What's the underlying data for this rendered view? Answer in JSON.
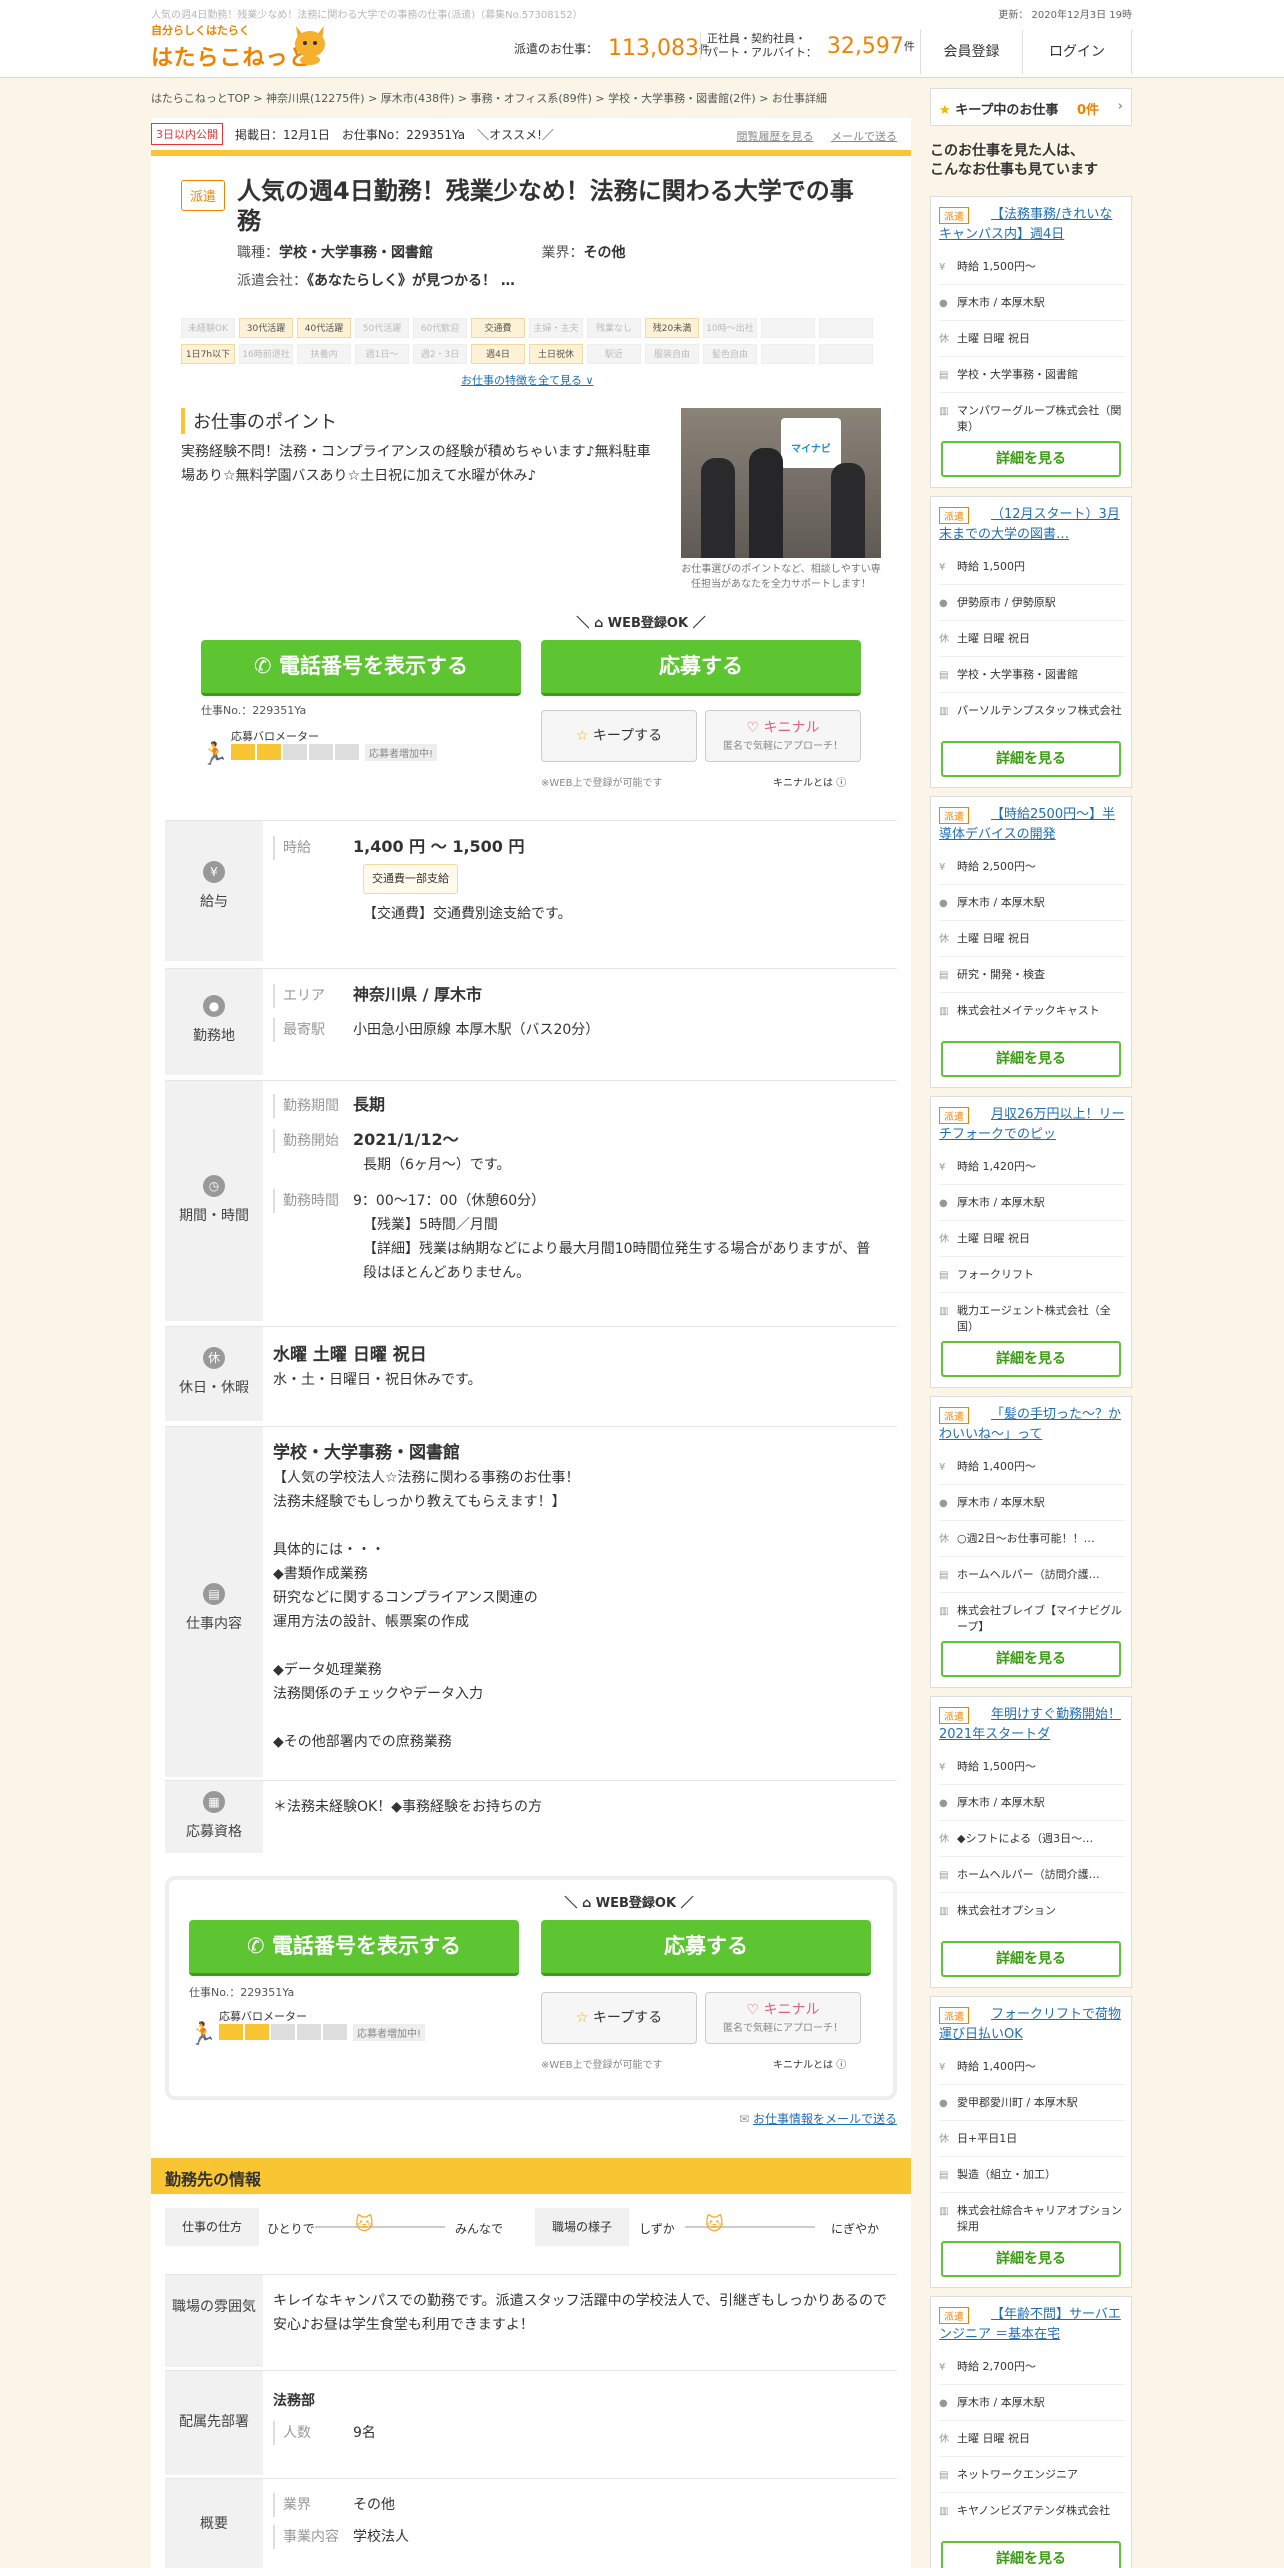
{
  "header": {
    "top_note": "人気の週4日勤務！残業少なめ！法務に関わる大学での事務の仕事(派遣)（募集No.57308152）",
    "updated": "更新： 2020年12月3日 19時",
    "logo_small": "自分らしくはたらく",
    "logo_main": "はたらこねっと",
    "count1_label": "派遣のお仕事：",
    "count1_value": "113,083",
    "count1_unit": "件",
    "count2_label1": "正社員・契約社員・",
    "count2_label2": "パート・アルバイト：",
    "count2_value": "32,597",
    "count2_unit": "件",
    "register": "会員登録",
    "login": "ログイン"
  },
  "breadcrumb": "はたらこねっとTOP > 神奈川県(12275件) > 厚木市(438件) > 事務・オフィス系(89件) > 学校・大学事務・図書館(2件) > お仕事詳細",
  "meta": {
    "new_tag": "3日以内公開",
    "posted": "掲載日：12月1日",
    "job_no": "お仕事No：229351Ya",
    "recommend": "＼オススメ!／",
    "history": "閲覧履歴を見る",
    "mail": "メールで送る"
  },
  "job": {
    "type_badge": "派遣",
    "title": "人気の週4日勤務！残業少なめ！法務に関わる大学での事務",
    "category_label": "職種：",
    "category": "学校・大学事務・図書館",
    "industry_label": "業界：",
    "industry": "その他",
    "company_label": "派遣会社：",
    "company": "《あなたらしく》が見つかる！ …"
  },
  "tags": [
    {
      "t": "未経験OK",
      "on": false
    },
    {
      "t": "30代活躍",
      "on": true
    },
    {
      "t": "40代活躍",
      "on": true
    },
    {
      "t": "50代活躍",
      "on": false
    },
    {
      "t": "60代歓迎",
      "on": false
    },
    {
      "t": "交通費",
      "on": true
    },
    {
      "t": "主婦・主夫",
      "on": false
    },
    {
      "t": "残業なし",
      "on": false
    },
    {
      "t": "残20未満",
      "on": true
    },
    {
      "t": "10時～出社",
      "on": false
    },
    {
      "t": "",
      "on": false
    },
    {
      "t": "",
      "on": false
    },
    {
      "t": "1日7h以下",
      "on": true
    },
    {
      "t": "16時前退社",
      "on": false
    },
    {
      "t": "扶養内",
      "on": false
    },
    {
      "t": "週1日～",
      "on": false
    },
    {
      "t": "週2・3日",
      "on": false
    },
    {
      "t": "週4日",
      "on": true
    },
    {
      "t": "土日祝休",
      "on": true
    },
    {
      "t": "駅近",
      "on": false
    },
    {
      "t": "服装自由",
      "on": false
    },
    {
      "t": "髪色自由",
      "on": false
    },
    {
      "t": "",
      "on": false
    },
    {
      "t": "",
      "on": false
    }
  ],
  "more_features": "お仕事の特徴を全て見る ∨",
  "point": {
    "title": "お仕事のポイント",
    "text": "実務経験不問！法務・コンプライアンスの経験が積めちゃいます♪無料駐車場あり☆無料学園バスあり☆土日祝に加えて水曜が休み♪",
    "photo_caption": "お仕事選びのポイントなど、相談しやすい専任担当があなたを全力サポートします！",
    "photo_logo": "マイナビ"
  },
  "cta": {
    "web_ok": "WEB登録OK",
    "phone": "電話番号を表示する",
    "apply": "応募する",
    "job_no": "仕事No.：229351Ya",
    "barometer": "応募バロメーター",
    "barometer_level": "2/5",
    "increasing": "応募者増加中!",
    "keep": "キープする",
    "kininaru": "キニナル",
    "kininaru_sub": "匿名で気軽にアプローチ！",
    "web_note": "※WEB上で登録が可能です",
    "kininaru_what": "キニナルとは"
  },
  "details": {
    "salary": {
      "label": "給与",
      "key": "時給",
      "value": "1,400 円 ～ 1,500 円",
      "chip": "交通費一部支給",
      "note": "【交通費】交通費別途支給です。"
    },
    "location": {
      "label": "勤務地",
      "area_key": "エリア",
      "area": "神奈川県 / 厚木市",
      "station_key": "最寄駅",
      "station": "小田急小田原線 本厚木駅（バス20分）"
    },
    "period": {
      "label": "期間・時間",
      "p_key": "勤務期間",
      "p": "長期",
      "s_key": "勤務開始",
      "s": "2021/1/12～",
      "s_note": "長期（6ヶ月～）です。",
      "t_key": "勤務時間",
      "t1": "9：00～17：00（休憩60分）",
      "t2": "【残業】5時間／月間",
      "t3": "【詳細】残業は納期などにより最大月間10時間位発生する場合がありますが、普段はほとんどありません。"
    },
    "holiday": {
      "label": "休日・休暇",
      "title": "水曜 土曜 日曜 祝日",
      "text": "水・土・日曜日・祝日休みです。"
    },
    "work": {
      "label": "仕事内容",
      "title": "学校・大学事務・図書館",
      "lines": [
        "【人気の学校法人☆法務に関わる事務のお仕事！",
        "法務未経験でもしっかり教えてもらえます！】",
        "",
        "具体的には・・・",
        "◆書類作成業務",
        "研究などに関するコンプライアンス関連の",
        "運用方法の設計、帳票案の作成",
        "",
        "◆データ処理業務",
        "法務関係のチェックやデータ入力",
        "",
        "◆その他部署内での庶務業務"
      ]
    },
    "qual": {
      "label": "応募資格",
      "text": "＊法務未経験OK！◆事務経験をお持ちの方"
    }
  },
  "mail_info": "お仕事情報をメールで送る",
  "workplace": {
    "title": "勤務先の情報",
    "style_label": "仕事の仕方",
    "style_left": "ひとりで",
    "style_right": "みんなで",
    "atm_label": "職場の様子",
    "atm_left": "しずか",
    "atm_right": "にぎやか",
    "mood_label": "職場の雰囲気",
    "mood_text": "キレイなキャンパスでの勤務です。派遣スタッフ活躍中の学校法人で、引継ぎもしっかりあるので安心♪お昼は学生食堂も利用できますよ！",
    "dept_label": "配属先部署",
    "dept_name": "法務部",
    "dept_k": "人数",
    "dept_v": "9名",
    "ov_label": "概要",
    "ov_k1": "業界",
    "ov_v1": "その他",
    "ov_k2": "事業内容",
    "ov_v2": "学校法人"
  },
  "sidebar": {
    "keep": "キープ中のお仕事",
    "keep_count": "0件",
    "title1": "このお仕事を見た人は、",
    "title2": "こんなお仕事も見ています",
    "detail_btn": "詳細を見る",
    "cards": [
      {
        "tag": "派遣",
        "title": "【法務事務/きれいなキャンパス内】週4日",
        "pay": "時給 1,500円～",
        "loc": "厚木市 / 本厚木駅",
        "days": "土曜 日曜 祝日",
        "cat": "学校・大学事務・図書館",
        "co": "マンパワーグループ株式会社（関東）"
      },
      {
        "tag": "派遣",
        "title": "（12月スタート）3月末までの大学の図書…",
        "pay": "時給 1,500円",
        "loc": "伊勢原市 / 伊勢原駅",
        "days": "土曜 日曜 祝日",
        "cat": "学校・大学事務・図書館",
        "co": "パーソルテンプスタッフ株式会社"
      },
      {
        "tag": "派遣",
        "title": "【時給2500円～】半導体デバイスの開発",
        "pay": "時給 2,500円～",
        "loc": "厚木市 / 本厚木駅",
        "days": "土曜 日曜 祝日",
        "cat": "研究・開発・検査",
        "co": "株式会社メイテックキャスト"
      },
      {
        "tag": "派遣",
        "title": "月収26万円以上！リーチフォークでのピッ",
        "pay": "時給 1,420円～",
        "loc": "厚木市 / 本厚木駅",
        "days": "土曜 日曜 祝日",
        "cat": "フォークリフト",
        "co": "戦力エージェント株式会社（全国）"
      },
      {
        "tag": "派遣",
        "title": "「髪の手切った～？かわいいね～」って",
        "pay": "時給 1,400円～",
        "loc": "厚木市 / 本厚木駅",
        "days": "○週2日～お仕事可能！！…",
        "cat": "ホームヘルパー（訪問介護…",
        "co": "株式会社ブレイブ【マイナビグループ】"
      },
      {
        "tag": "派遣",
        "title": "年明けすぐ勤務開始！2021年スタートダ",
        "pay": "時給 1,500円～",
        "loc": "厚木市 / 本厚木駅",
        "days": "◆シフトによる（週3日～…",
        "cat": "ホームヘルパー（訪問介護…",
        "co": "株式会社オプション"
      },
      {
        "tag": "派遣",
        "title": "フォークリフトで荷物運び日払いOK",
        "pay": "時給 1,400円～",
        "loc": "愛甲郡愛川町 / 本厚木駅",
        "days": "日+平日1日",
        "cat": "製造（組立・加工）",
        "co": "株式会社綜合キャリアオプション　採用"
      },
      {
        "tag": "派遣",
        "title": "【年齢不問】サーバエンジニア ＝基本在宅",
        "pay": "時給 2,700円～",
        "loc": "厚木市 / 本厚木駅",
        "days": "土曜 日曜 祝日",
        "cat": "ネットワークエンジニア",
        "co": "キヤノンビズアテンダ株式会社"
      }
    ]
  },
  "colors": {
    "brand": "#f08200",
    "accent_yellow": "#f9c532",
    "green": "#5dc531",
    "bg": "#faf5e6"
  }
}
